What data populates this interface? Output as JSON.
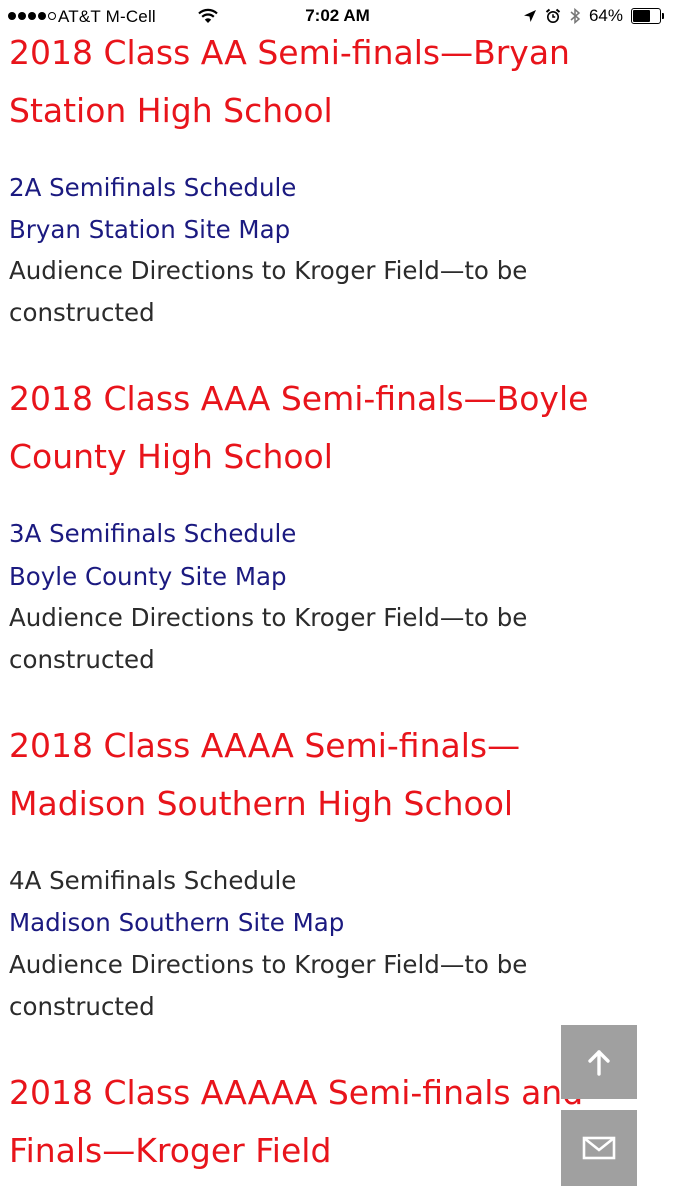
{
  "status_bar": {
    "carrier": "AT&T M-Cell",
    "time": "7:02 AM",
    "battery_percent": "64%",
    "battery_level": 0.64,
    "signal_bars_filled": 4,
    "signal_bars_total": 5
  },
  "sections": [
    {
      "heading_line1": "2018 Class AA Semi-finals—Bryan",
      "heading_line2": "Station High School",
      "schedule": "2A Semifinals Schedule",
      "site_map": "Bryan Station Site Map",
      "directions_line1": "Audience Directions to Kroger Field—to be",
      "directions_line2": "constructed"
    },
    {
      "heading_line1": "2018 Class AAA Semi-finals—Boyle",
      "heading_line2": "County High School",
      "schedule": "3A Semifinals Schedule",
      "site_map": "Boyle County Site Map",
      "directions_line1": "Audience Directions to Kroger Field—to be",
      "directions_line2": "constructed"
    },
    {
      "heading_line1": "2018 Class AAAA Semi-finals—",
      "heading_line2": "Madison Southern High School",
      "schedule": "4A Semifinals Schedule",
      "site_map": "Madison Southern Site Map",
      "directions_line1": "Audience Directions to Kroger Field—to be",
      "directions_line2": "constructed"
    },
    {
      "heading_line1": "2018 Class AAAAA Semi-finals and",
      "heading_line2": "Finals—Kroger Field"
    }
  ],
  "colors": {
    "heading": "#e8141b",
    "link": "#1b1a80",
    "text": "#2b2b2b",
    "float_button": "#a0a0a0"
  },
  "icons": {
    "back_to_top": "arrow-up-icon",
    "contact": "envelope-icon"
  }
}
